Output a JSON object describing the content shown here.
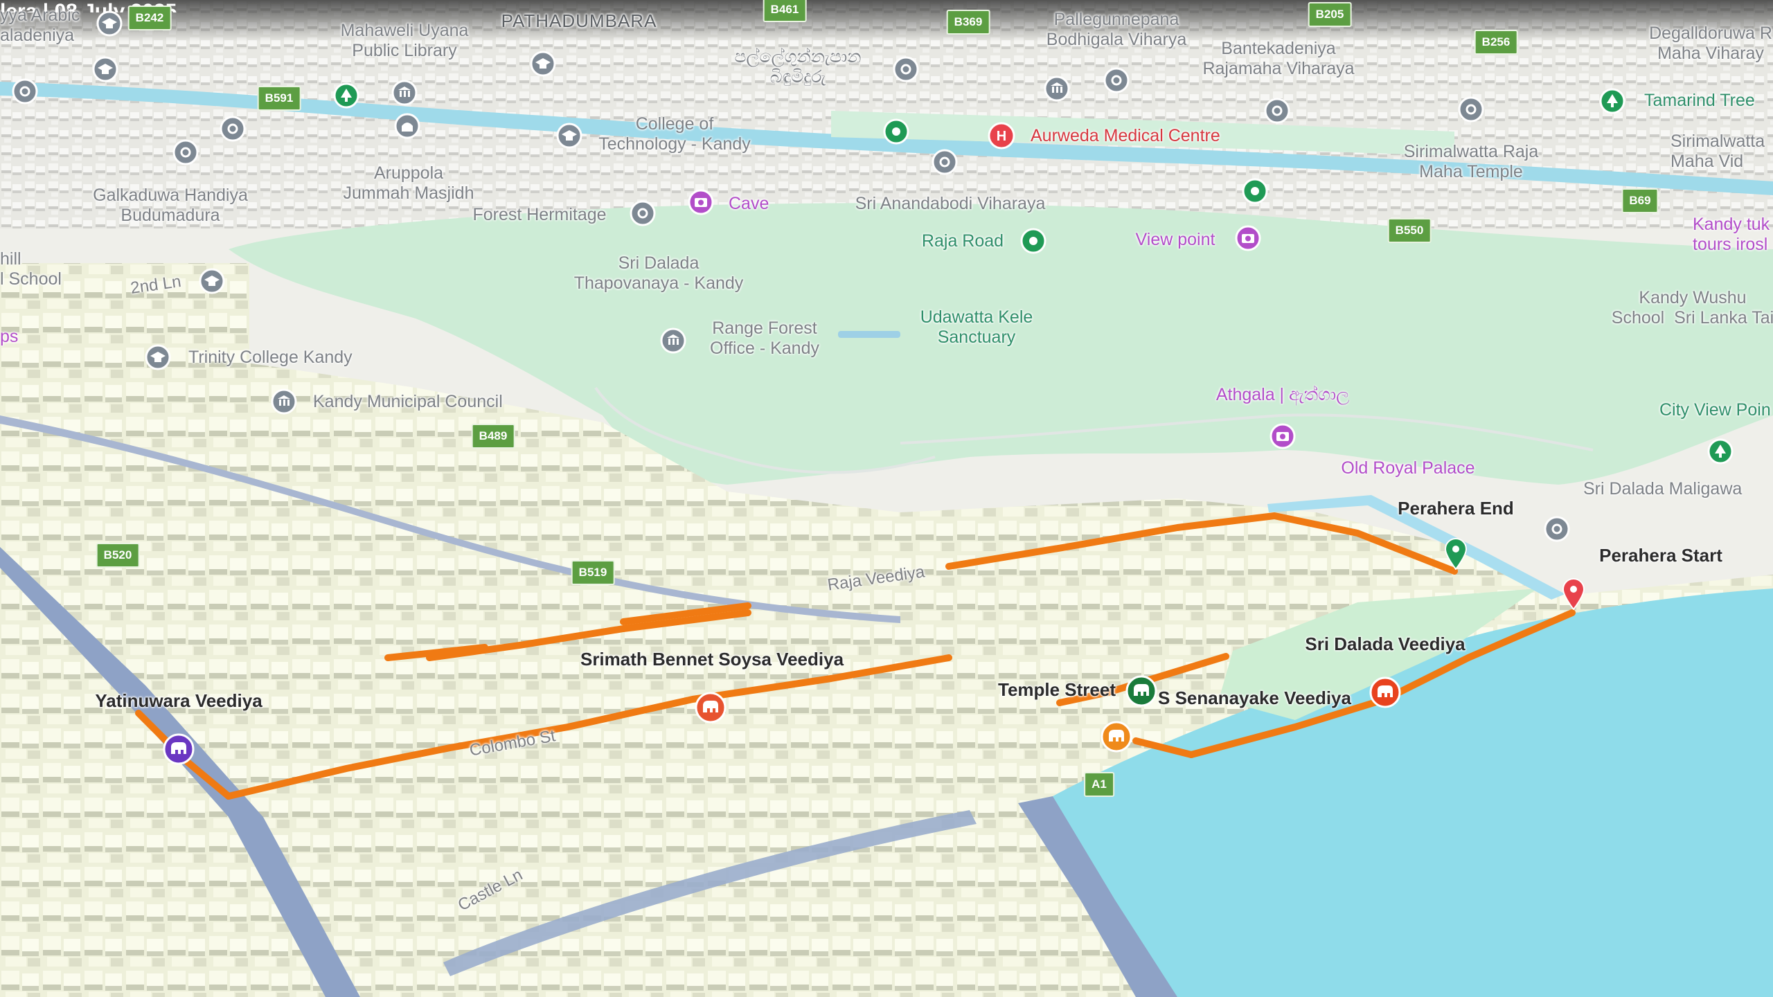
{
  "header_fragment": "lera | 08 July 2025",
  "colors": {
    "route": "#f07a13",
    "lake": "#8fdcea",
    "park": "#cfeed9",
    "building": "#f6f7e2",
    "major_road": "#8ea2c6",
    "shield": "#5c9e42"
  },
  "place_labels": [
    {
      "text": "PATHADUMBARA",
      "kind": "place"
    },
    {
      "text": "Mahaweli Uyana\nPublic Library",
      "kind": "poi"
    },
    {
      "text": "පල්ලේගුන්නැපාන\nබිඳුමිදුරු",
      "kind": "poi"
    },
    {
      "text": "Pallegunnepana\nBodhigala Viharya",
      "kind": "poi"
    },
    {
      "text": "Bantekadeniya\nRajamaha Viharaya",
      "kind": "poi"
    },
    {
      "text": "Degalldoruwa R\nMaha Viharay",
      "kind": "poi"
    },
    {
      "text": "yya Arabic\naladeniya",
      "kind": "poi"
    },
    {
      "text": "College of\nTechnology - Kandy",
      "kind": "poi"
    },
    {
      "text": "Aurweda Medical Centre",
      "kind": "red"
    },
    {
      "text": "Tamarind Tree",
      "kind": "green"
    },
    {
      "text": "Sirimalwatta Raja\nMaha Temple",
      "kind": "poi"
    },
    {
      "text": "Sirimalwatta\nMaha Vid",
      "kind": "poi"
    },
    {
      "text": "Aruppola\nJummah Masjidh",
      "kind": "poi"
    },
    {
      "text": "Galkaduwa Handiya\nBudumadura",
      "kind": "poi"
    },
    {
      "text": "Forest Hermitage",
      "kind": "poi"
    },
    {
      "text": "Cave",
      "kind": "purple"
    },
    {
      "text": "Sri Anandabodi Viharaya",
      "kind": "poi"
    },
    {
      "text": "Raja Road",
      "kind": "green"
    },
    {
      "text": "View point",
      "kind": "purple"
    },
    {
      "text": "Kandy tuk\ntours irosl",
      "kind": "purple"
    },
    {
      "text": "hill\nl School",
      "kind": "poi"
    },
    {
      "text": "2nd Ln",
      "kind": "road"
    },
    {
      "text": "Sri Dalada\nThapovanaya - Kandy",
      "kind": "poi"
    },
    {
      "text": "Udawatta Kele\nSanctuary",
      "kind": "green"
    },
    {
      "text": "Kandy Wushu\nSchool  Sri Lanka Tai",
      "kind": "poi"
    },
    {
      "text": "Range Forest\nOffice - Kandy",
      "kind": "poi"
    },
    {
      "text": "ps",
      "kind": "purple"
    },
    {
      "text": "Trinity College Kandy",
      "kind": "poi"
    },
    {
      "text": "Kandy Municipal Council",
      "kind": "poi"
    },
    {
      "text": "Athgala | ඇත්ගාල",
      "kind": "purple"
    },
    {
      "text": "City View Poin",
      "kind": "green"
    },
    {
      "text": "Old Royal Palace",
      "kind": "purple"
    },
    {
      "text": "Sri Dalada Maligawa",
      "kind": "poi"
    },
    {
      "text": "Raja Veediya",
      "kind": "road"
    },
    {
      "text": "Colombo St",
      "kind": "road"
    },
    {
      "text": "Castle Ln",
      "kind": "road"
    }
  ],
  "event_labels": [
    {
      "text": "Perahera End"
    },
    {
      "text": "Perahera Start"
    },
    {
      "text": "Sri Dalada Veediya"
    },
    {
      "text": "Temple Street"
    },
    {
      "text": "D S Senanayake Veediya"
    },
    {
      "text": "Srimath Bennet Soysa Veediya"
    },
    {
      "text": "Yatinuwara Veediya"
    }
  ],
  "road_shields": [
    "B242",
    "B461",
    "B369",
    "B205",
    "B256",
    "B591",
    "B69",
    "B550",
    "B489",
    "B520",
    "B519",
    "A1"
  ],
  "markers": [
    {
      "icon": "perahera-end-pin-icon",
      "color": "#1f9a55"
    },
    {
      "icon": "perahera-start-pin-icon",
      "color": "#e8424b"
    },
    {
      "icon": "elephant-icon",
      "color": "#e7532f"
    },
    {
      "icon": "elephant-icon",
      "color": "#e8421e"
    },
    {
      "icon": "elephant-icon",
      "color": "#ef8a1b"
    },
    {
      "icon": "elephant-icon",
      "color": "#1a7b3b"
    },
    {
      "icon": "elephant-icon",
      "color": "#6a37c2"
    },
    {
      "icon": "hospital-icon",
      "color": "#e8424b"
    },
    {
      "icon": "camera-icon",
      "color": "#b24dc9"
    },
    {
      "icon": "camera-icon",
      "color": "#b24dc9"
    },
    {
      "icon": "camera-icon",
      "color": "#b24dc9"
    },
    {
      "icon": "school-icon",
      "color": "#7d8893"
    },
    {
      "icon": "temple-icon",
      "color": "#7d8893"
    },
    {
      "icon": "government-icon",
      "color": "#7d8893"
    },
    {
      "icon": "tree-icon",
      "color": "#1f9a55"
    },
    {
      "icon": "landmark-icon",
      "color": "#1f9a55"
    }
  ]
}
